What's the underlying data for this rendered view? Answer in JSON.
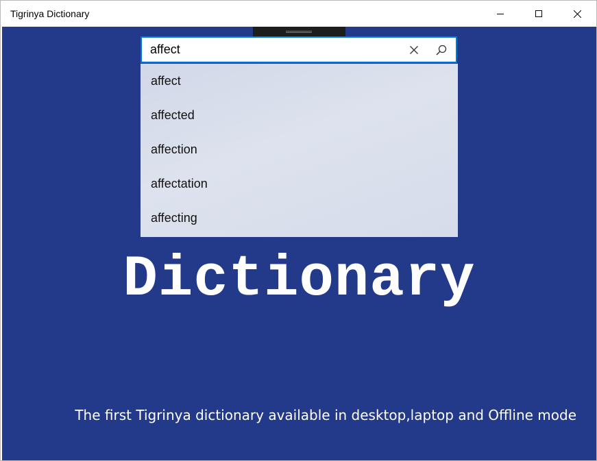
{
  "window": {
    "title": "Tigrinya Dictionary",
    "controls": {
      "minimize_icon": "minimize-icon",
      "maximize_icon": "maximize-icon",
      "close_icon": "close-icon"
    }
  },
  "search": {
    "value": "affect",
    "placeholder": "",
    "clear_icon": "clear-icon",
    "search_icon": "search-icon",
    "suggestions": [
      "affect",
      "affected",
      "affection",
      "affectation",
      "affecting"
    ]
  },
  "main": {
    "heading": "Dictionary",
    "tagline": "The first Tigrinya dictionary available in desktop,laptop and Offline mode"
  },
  "colors": {
    "background": "#233a8b",
    "accent": "#0078d7",
    "suggestion_bg": "#d8dded",
    "text_light": "#ffffff"
  }
}
